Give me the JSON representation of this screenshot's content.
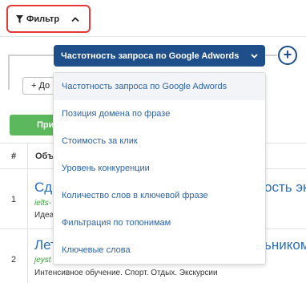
{
  "filter_button": {
    "label": "Фильтр",
    "icon": "filter-icon"
  },
  "builder": {
    "selected_condition": "Частотность запроса по Google Adwords",
    "add_label": "+ До",
    "apply_label": "При",
    "add_condition_icon": "plus-circle-icon"
  },
  "dropdown": {
    "items": [
      "Частотность запроса по Google Adwords",
      "Позиция домена по фразе",
      "Стоимость за клик",
      "Уровень конкуренции",
      "Количество слов в ключевой фразе",
      "Фильтрация по топонимам",
      "Ключевые слова"
    ]
  },
  "table": {
    "columns": [
      "#",
      "Объ"
    ],
    "rows": [
      {
        "num": "1",
        "title": "Сда",
        "title_tail": "ость экз",
        "url": "ielts-",
        "desc": "Идеа"
      },
      {
        "num": "2",
        "title": "Лет",
        "title_tail": "ьником",
        "url": "jeyst",
        "desc": "Интенсивное обучение. Спорт. Отдых. Экскурсии"
      }
    ]
  },
  "colors": {
    "highlight": "#e53935",
    "selected_bg": "#1e4f8a",
    "apply_bg": "#5cb85c",
    "link": "#2a6ebb"
  }
}
